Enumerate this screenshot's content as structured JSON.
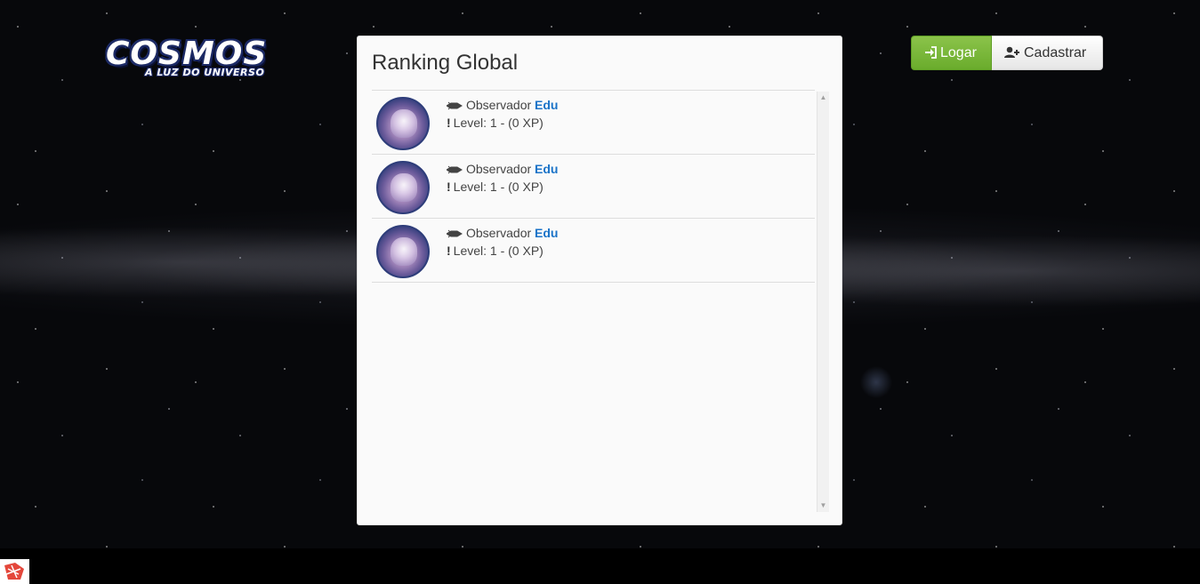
{
  "brand": {
    "name": "COSMOS",
    "tagline": "A LUZ DO UNIVERSO"
  },
  "header": {
    "login_label": "Logar",
    "register_label": "Cadastrar"
  },
  "ranking": {
    "title": "Ranking Global",
    "entries": [
      {
        "rank_title": "Observador",
        "name": "Edu",
        "level_text": "Level: 1 - (0 XP)"
      },
      {
        "rank_title": "Observador",
        "name": "Edu",
        "level_text": "Level: 1 - (0 XP)"
      },
      {
        "rank_title": "Observador",
        "name": "Edu",
        "level_text": "Level: 1 - (0 XP)"
      }
    ]
  },
  "colors": {
    "login_green": "#7cb93b",
    "name_blue": "#1a73c8",
    "panel_bg": "#fafafa"
  },
  "icons": {
    "login": "sign-in-icon",
    "register": "user-plus-icon",
    "rank": "rocket-icon",
    "level": "exclamation-icon"
  }
}
